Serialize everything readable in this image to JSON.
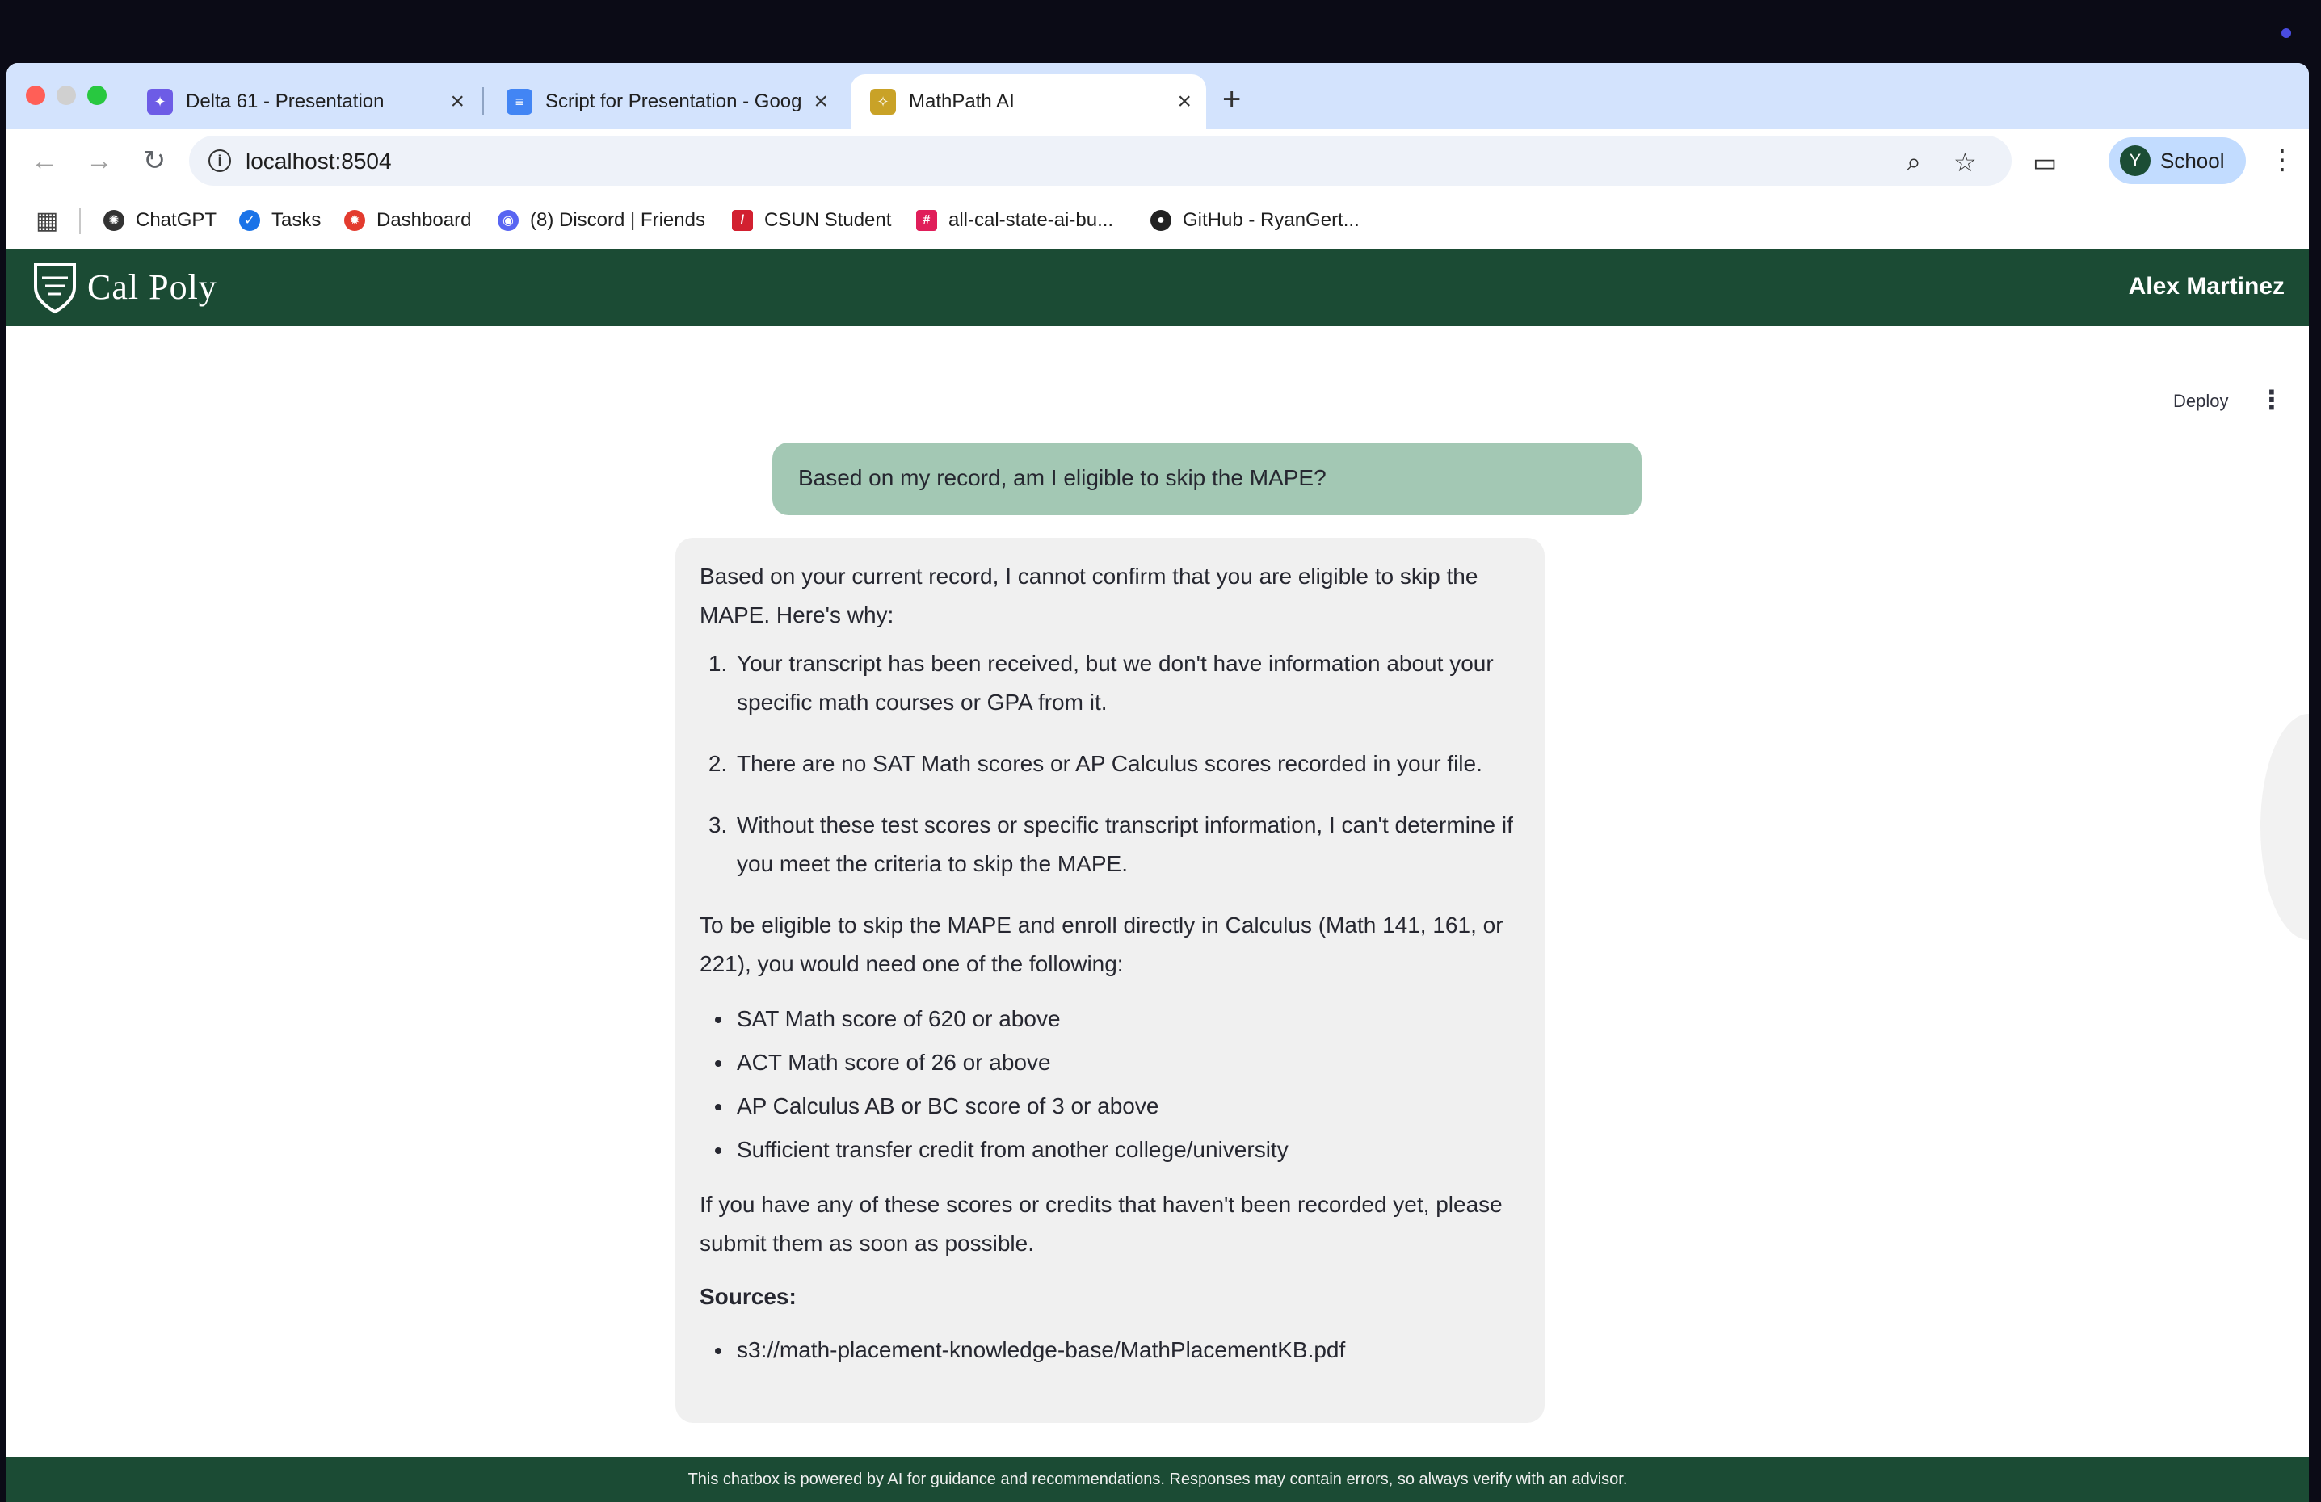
{
  "browser": {
    "tabs": [
      {
        "title": "Delta 61 - Presentation",
        "icon": "presentation-icon"
      },
      {
        "title": "Script for Presentation - Goog",
        "icon": "docs-icon"
      },
      {
        "title": "MathPath AI",
        "icon": "calpoly-icon"
      }
    ],
    "url": "localhost:8504",
    "profile_initial": "Y",
    "profile_label": "School",
    "bookmarks": [
      {
        "label": "ChatGPT",
        "icon": "chatgpt-icon"
      },
      {
        "label": "Tasks",
        "icon": "tasks-icon"
      },
      {
        "label": "Dashboard",
        "icon": "dashboard-icon"
      },
      {
        "label": "(8) Discord | Friends",
        "icon": "discord-icon"
      },
      {
        "label": "CSUN Student",
        "icon": "csun-icon"
      },
      {
        "label": "all-cal-state-ai-bu...",
        "icon": "slack-icon"
      },
      {
        "label": "GitHub - RyanGert...",
        "icon": "github-icon"
      }
    ]
  },
  "app": {
    "logo_text": "Cal Poly",
    "user_name": "Alex Martinez",
    "deploy_label": "Deploy",
    "accent_color": "#1b4b34",
    "user_bubble_color": "#a3c8b4"
  },
  "chat": {
    "user_message": "Based on my record, am I eligible to skip the MAPE?",
    "ai_intro": "Based on your current record, I cannot confirm that you are eligible to skip the MAPE. Here's why:",
    "ai_reasons": [
      "Your transcript has been received, but we don't have information about your specific math courses or GPA from it.",
      "There are no SAT Math scores or AP Calculus scores recorded in your file.",
      "Without these test scores or specific transcript information, I can't determine if you meet the criteria to skip the MAPE."
    ],
    "ai_requirements_intro": "To be eligible to skip the MAPE and enroll directly in Calculus (Math 141, 161, or 221), you would need one of the following:",
    "ai_requirements": [
      "SAT Math score of 620 or above",
      "ACT Math score of 26 or above",
      "AP Calculus AB or BC score of 3 or above",
      "Sufficient transfer credit from another college/university"
    ],
    "ai_closing": "If you have any of these scores or credits that haven't been recorded yet, please submit them as soon as possible.",
    "sources_title": "Sources:",
    "sources": [
      "s3://math-placement-knowledge-base/MathPlacementKB.pdf"
    ]
  },
  "footer_text": "This chatbox is powered by AI for guidance and recommendations. Responses may contain errors, so always verify with an advisor."
}
